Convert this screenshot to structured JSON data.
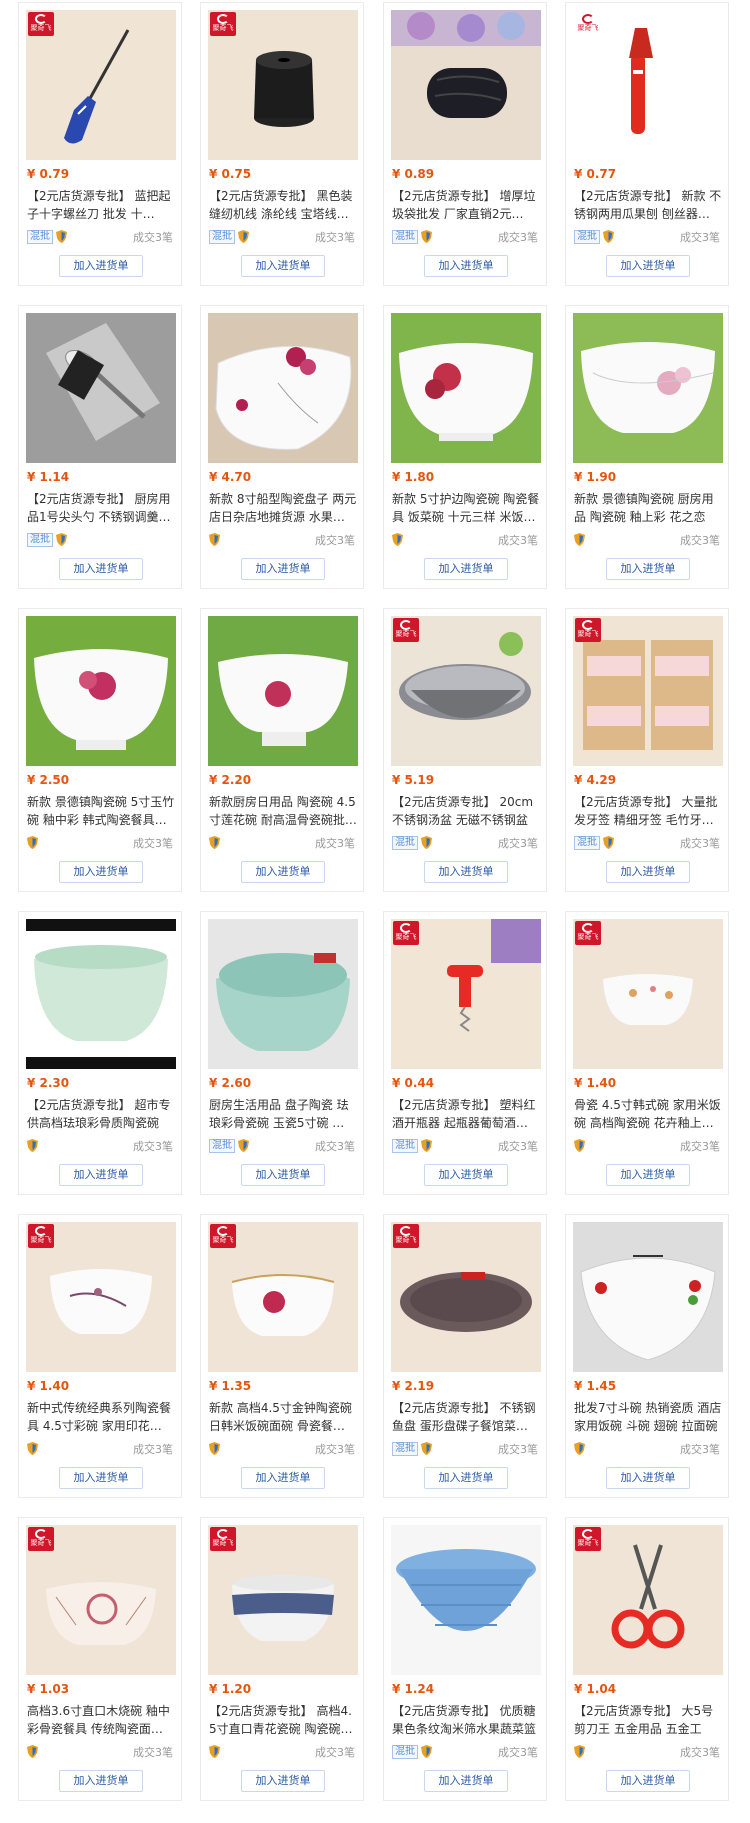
{
  "products": [
    {
      "price": "¥ 0.79",
      "title": "【2元店货源专批】 蓝把起子十字螺丝刀 批发 十…",
      "hunpi": "混批",
      "deal": "成交3笔",
      "button": "加入进货单",
      "img": "screwdriver",
      "logo": "red"
    },
    {
      "price": "¥ 0.75",
      "title": "【2元店货源专批】 黑色装缝纫机线 涤纶线 宝塔线…",
      "hunpi": "混批",
      "deal": "成交3笔",
      "button": "加入进货单",
      "img": "thread",
      "logo": "red"
    },
    {
      "price": "¥ 0.89",
      "title": "【2元店货源专批】 增厚垃圾袋批发 厂家直销2元…",
      "hunpi": "混批",
      "deal": "成交3笔",
      "button": "加入进货单",
      "img": "bags",
      "logo": "none"
    },
    {
      "price": "¥ 0.77",
      "title": "【2元店货源专批】 新款 不锈钢两用瓜果刨 刨丝器…",
      "hunpi": "混批",
      "deal": "成交3笔",
      "button": "加入进货单",
      "img": "peeler",
      "logo": "white"
    },
    {
      "price": "¥ 1.14",
      "title": "【2元店货源专批】 厨房用品1号尖头勺 不锈钢调羹…",
      "hunpi": "混批",
      "deal": "",
      "button": "加入进货单",
      "img": "spoon",
      "logo": "none"
    },
    {
      "price": "¥ 4.70",
      "title": "新款 8寸船型陶瓷盘子 两元店日杂店地摊货源 水果…",
      "hunpi": "",
      "deal": "成交3笔",
      "button": "加入进货单",
      "img": "plate",
      "logo": "none"
    },
    {
      "price": "¥ 1.80",
      "title": "新款 5寸护边陶瓷碗 陶瓷餐具 饭菜碗 十元三样 米饭…",
      "hunpi": "",
      "deal": "成交3笔",
      "button": "加入进货单",
      "img": "bowl-rose",
      "logo": "none"
    },
    {
      "price": "¥ 1.90",
      "title": "新款 景德镇陶瓷碗 厨房用品 陶瓷碗 釉上彩 花之恋",
      "hunpi": "",
      "deal": "成交3笔",
      "button": "加入进货单",
      "img": "bowl-pink",
      "logo": "none"
    },
    {
      "price": "¥ 2.50",
      "title": "新款 景德镇陶瓷碗 5寸玉竹碗 釉中彩 韩式陶瓷餐具…",
      "hunpi": "",
      "deal": "成交3笔",
      "button": "加入进货单",
      "img": "bowl-green1",
      "logo": "none"
    },
    {
      "price": "¥ 2.20",
      "title": "新款厨房日用品 陶瓷碗 4.5寸莲花碗 耐高温骨瓷碗批…",
      "hunpi": "",
      "deal": "成交3笔",
      "button": "加入进货单",
      "img": "bowl-green2",
      "logo": "none"
    },
    {
      "price": "¥ 5.19",
      "title": "【2元店货源专批】 20cm不锈钢汤盆 无磁不锈钢盆",
      "hunpi": "混批",
      "deal": "成交3笔",
      "button": "加入进货单",
      "img": "steelbowl",
      "logo": "red"
    },
    {
      "price": "¥ 4.29",
      "title": "【2元店货源专批】 大量批发牙签 精细牙签 毛竹牙…",
      "hunpi": "混批",
      "deal": "成交3笔",
      "button": "加入进货单",
      "img": "toothpick",
      "logo": "red"
    },
    {
      "price": "¥ 2.30",
      "title": "【2元店货源专批】 超市专供高档珐琅彩骨质陶瓷碗",
      "hunpi": "",
      "deal": "成交3笔",
      "button": "加入进货单",
      "img": "celadon",
      "logo": "none"
    },
    {
      "price": "¥ 2.60",
      "title": "厨房生活用品 盘子陶瓷 珐琅彩骨瓷碗 玉瓷5寸碗 …",
      "hunpi": "混批",
      "deal": "成交3笔",
      "button": "加入进货单",
      "img": "celadon2",
      "logo": "none"
    },
    {
      "price": "¥ 0.44",
      "title": "【2元店货源专批】 塑料红酒开瓶器 起瓶器葡萄酒…",
      "hunpi": "混批",
      "deal": "成交3笔",
      "button": "加入进货单",
      "img": "corkscrew",
      "logo": "red"
    },
    {
      "price": "¥ 1.40",
      "title": "骨瓷 4.5寸韩式碗 家用米饭碗 高档陶瓷碗 花卉釉上…",
      "hunpi": "",
      "deal": "成交3笔",
      "button": "加入进货单",
      "img": "smallbowl",
      "logo": "red"
    },
    {
      "price": "¥ 1.40",
      "title": "新中式传统经典系列陶瓷餐具 4.5寸彩碗 家用印花…",
      "hunpi": "",
      "deal": "成交3笔",
      "button": "加入进货单",
      "img": "bowl-white",
      "logo": "red"
    },
    {
      "price": "¥ 1.35",
      "title": "新款 高档4.5寸金钟陶瓷碗 日韩米饭碗面碗 骨瓷餐…",
      "hunpi": "",
      "deal": "成交3笔",
      "button": "加入进货单",
      "img": "bowl-gold",
      "logo": "red"
    },
    {
      "price": "¥ 2.19",
      "title": "【2元店货源专批】 不锈钢鱼盘 蛋形盘碟子餐馆菜…",
      "hunpi": "混批",
      "deal": "成交3笔",
      "button": "加入进货单",
      "img": "fishplate",
      "logo": "red"
    },
    {
      "price": "¥ 1.45",
      "title": "批发7寸斗碗 热销瓷质 酒店家用饭碗 斗碗 翅碗 拉面碗",
      "hunpi": "",
      "deal": "成交3笔",
      "button": "加入进货单",
      "img": "bigbowl",
      "logo": "none"
    },
    {
      "price": "¥ 1.03",
      "title": "高档3.6寸直口木烧碗 釉中彩骨瓷餐具 传统陶瓷面…",
      "hunpi": "",
      "deal": "成交3笔",
      "button": "加入进货单",
      "img": "bowl-peony",
      "logo": "red"
    },
    {
      "price": "¥ 1.20",
      "title": "【2元店货源专批】 高档4.5寸直口青花瓷碗 陶瓷碗…",
      "hunpi": "",
      "deal": "成交3笔",
      "button": "加入进货单",
      "img": "bowl-blue",
      "logo": "red"
    },
    {
      "price": "¥ 1.24",
      "title": "【2元店货源专批】 优质糖果色条纹淘米筛水果蔬菜篮",
      "hunpi": "混批",
      "deal": "成交3笔",
      "button": "加入进货单",
      "img": "basket",
      "logo": "none"
    },
    {
      "price": "¥ 1.04",
      "title": "【2元店货源专批】 大5号剪刀王 五金用品 五金工具…",
      "hunpi": "",
      "deal": "成交3笔",
      "button": "加入进货单",
      "img": "scissors",
      "logo": "red"
    }
  ],
  "logo_text": "聚奇飞",
  "colors": {
    "price": "#e4560f",
    "logo": "#d0172a",
    "button_text": "#2b5aa6"
  }
}
